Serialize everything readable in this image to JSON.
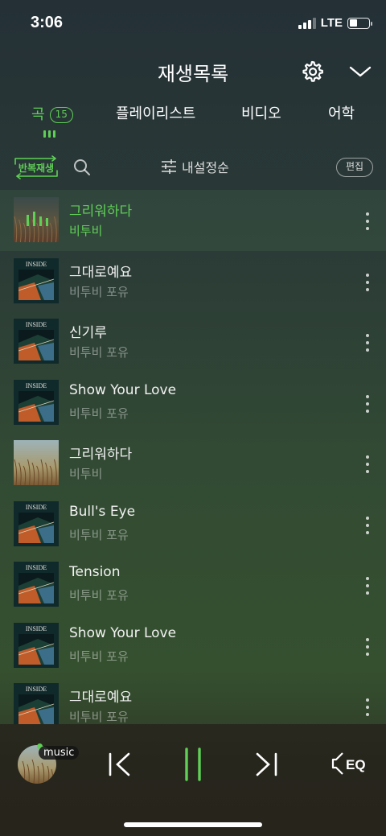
{
  "status": {
    "time": "3:06",
    "network": "LTE",
    "battery_percent": 40
  },
  "header": {
    "title": "재생목록",
    "settings_icon": "gear-icon",
    "collapse_icon": "chevron-down-icon"
  },
  "tabs": [
    {
      "label": "곡",
      "count": "15",
      "active": true
    },
    {
      "label": "플레이리스트"
    },
    {
      "label": "비디오"
    },
    {
      "label": "어학"
    }
  ],
  "toolbar": {
    "repeat_label": "반복재생",
    "sort_label": "내설정순",
    "edit_label": "편집"
  },
  "songs": [
    {
      "title": "그리워하다",
      "artist": "비투비",
      "art": "reed-dark",
      "playing": true
    },
    {
      "title": "그대로예요",
      "artist": "비투비 포유",
      "art": "inside"
    },
    {
      "title": "신기루",
      "artist": "비투비 포유",
      "art": "inside"
    },
    {
      "title": "Show Your Love",
      "artist": "비투비 포유",
      "art": "inside"
    },
    {
      "title": "그리워하다",
      "artist": "비투비",
      "art": "reed"
    },
    {
      "title": "Bull's Eye",
      "artist": "비투비 포유",
      "art": "inside"
    },
    {
      "title": "Tension",
      "artist": "비투비 포유",
      "art": "inside"
    },
    {
      "title": "Show Your Love",
      "artist": "비투비 포유",
      "art": "inside"
    },
    {
      "title": "그대로예요",
      "artist": "비투비 포유",
      "art": "inside"
    }
  ],
  "album_text": "INSIDE",
  "player": {
    "badge": "music",
    "eq_label": "EQ"
  },
  "colors": {
    "accent": "#5fcf56",
    "background_top": "#243036",
    "background_mid": "#35502f",
    "player_bg": "#27241c"
  }
}
